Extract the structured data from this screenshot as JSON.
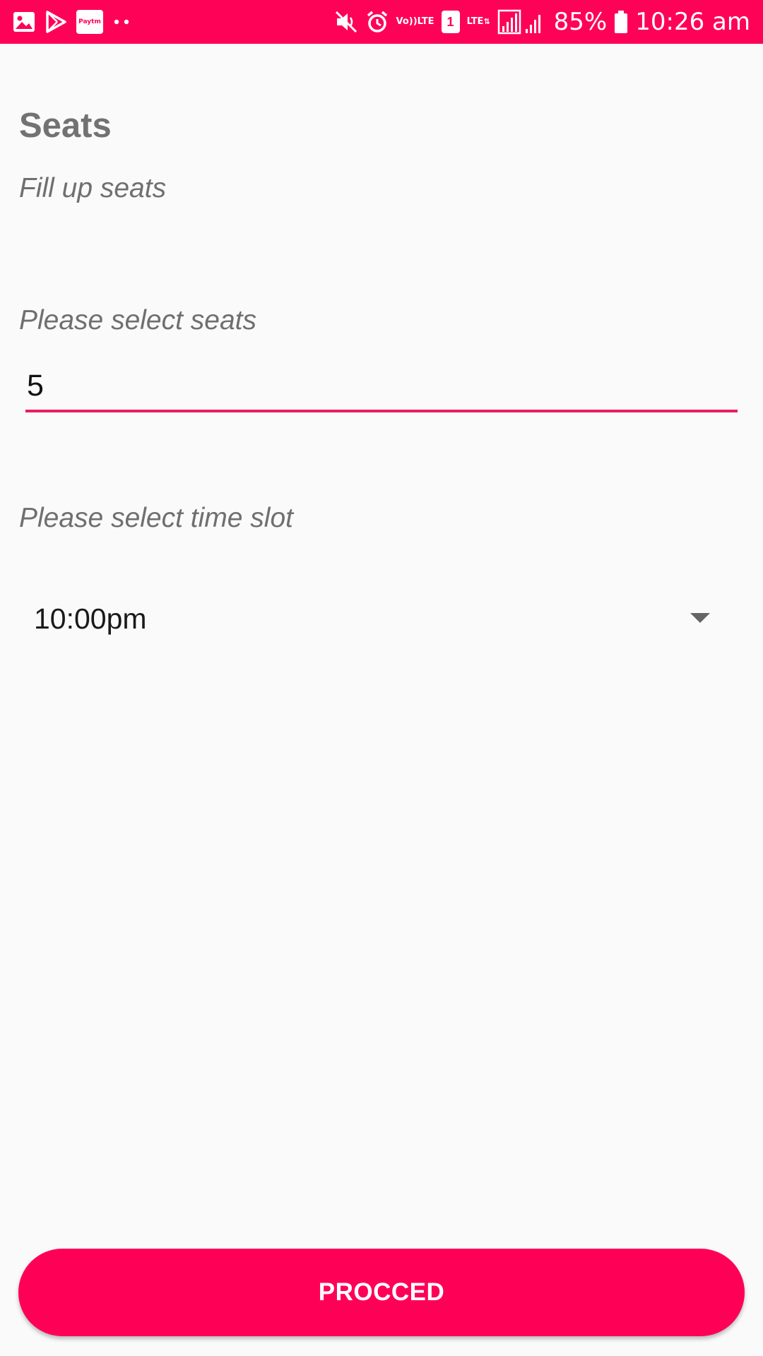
{
  "status_bar": {
    "paytm_label": "Paytm",
    "volte_line1": "Vo))",
    "volte_line2": "LTE",
    "sim_label": "1",
    "network_label": "LTE",
    "battery_percent": "85%",
    "time": "10:26 am",
    "background_color": "#fe0257",
    "icons": [
      "gallery-icon",
      "play-store-icon",
      "paytm-icon",
      "more-notifications-icon",
      "mute-icon",
      "alarm-icon",
      "volte-icon",
      "sim-icon",
      "signal-icon",
      "battery-icon"
    ]
  },
  "page": {
    "title": "Seats",
    "subtitle": "Fill up seats"
  },
  "seats_section": {
    "label": "Please select seats",
    "value": "5",
    "accent_color": "#e91e63"
  },
  "time_section": {
    "label": "Please select time slot",
    "selected": "10:00pm",
    "arrow_icon": "dropdown-arrow-icon"
  },
  "actions": {
    "proceed_label": "PROCCED",
    "button_color": "#ff0057"
  }
}
